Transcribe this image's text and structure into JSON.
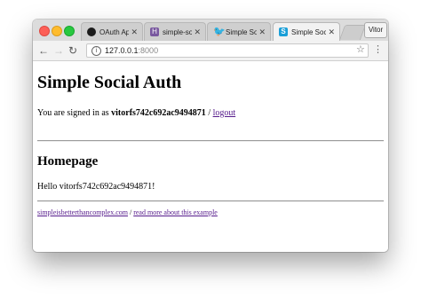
{
  "browser": {
    "tabs": [
      {
        "label": "OAuth Apps",
        "icon": "github-icon",
        "close": "✕"
      },
      {
        "label": "simple-social-auth",
        "icon": "heroku-icon",
        "close": "✕"
      },
      {
        "label": "Simple Social Auth",
        "icon": "twitter-icon",
        "close": "✕"
      },
      {
        "label": "Simple Social Auth",
        "icon": "simple-site-icon",
        "close": "✕"
      }
    ],
    "profile": "Vitor",
    "url_host": "127.0.0.1",
    "url_port": ":8000"
  },
  "page": {
    "title": "Simple Social Auth",
    "signed_in_prefix": "You are signed in as",
    "username": "vitorfs742c692ac9494871",
    "separator": "/",
    "logout": "logout",
    "heading": "Homepage",
    "hello": "Hello vitorfs742c692ac9494871!",
    "footer_link1": "simpleisbetterthancomplex.com",
    "footer_sep": "/",
    "footer_link2": "read more about this example"
  }
}
